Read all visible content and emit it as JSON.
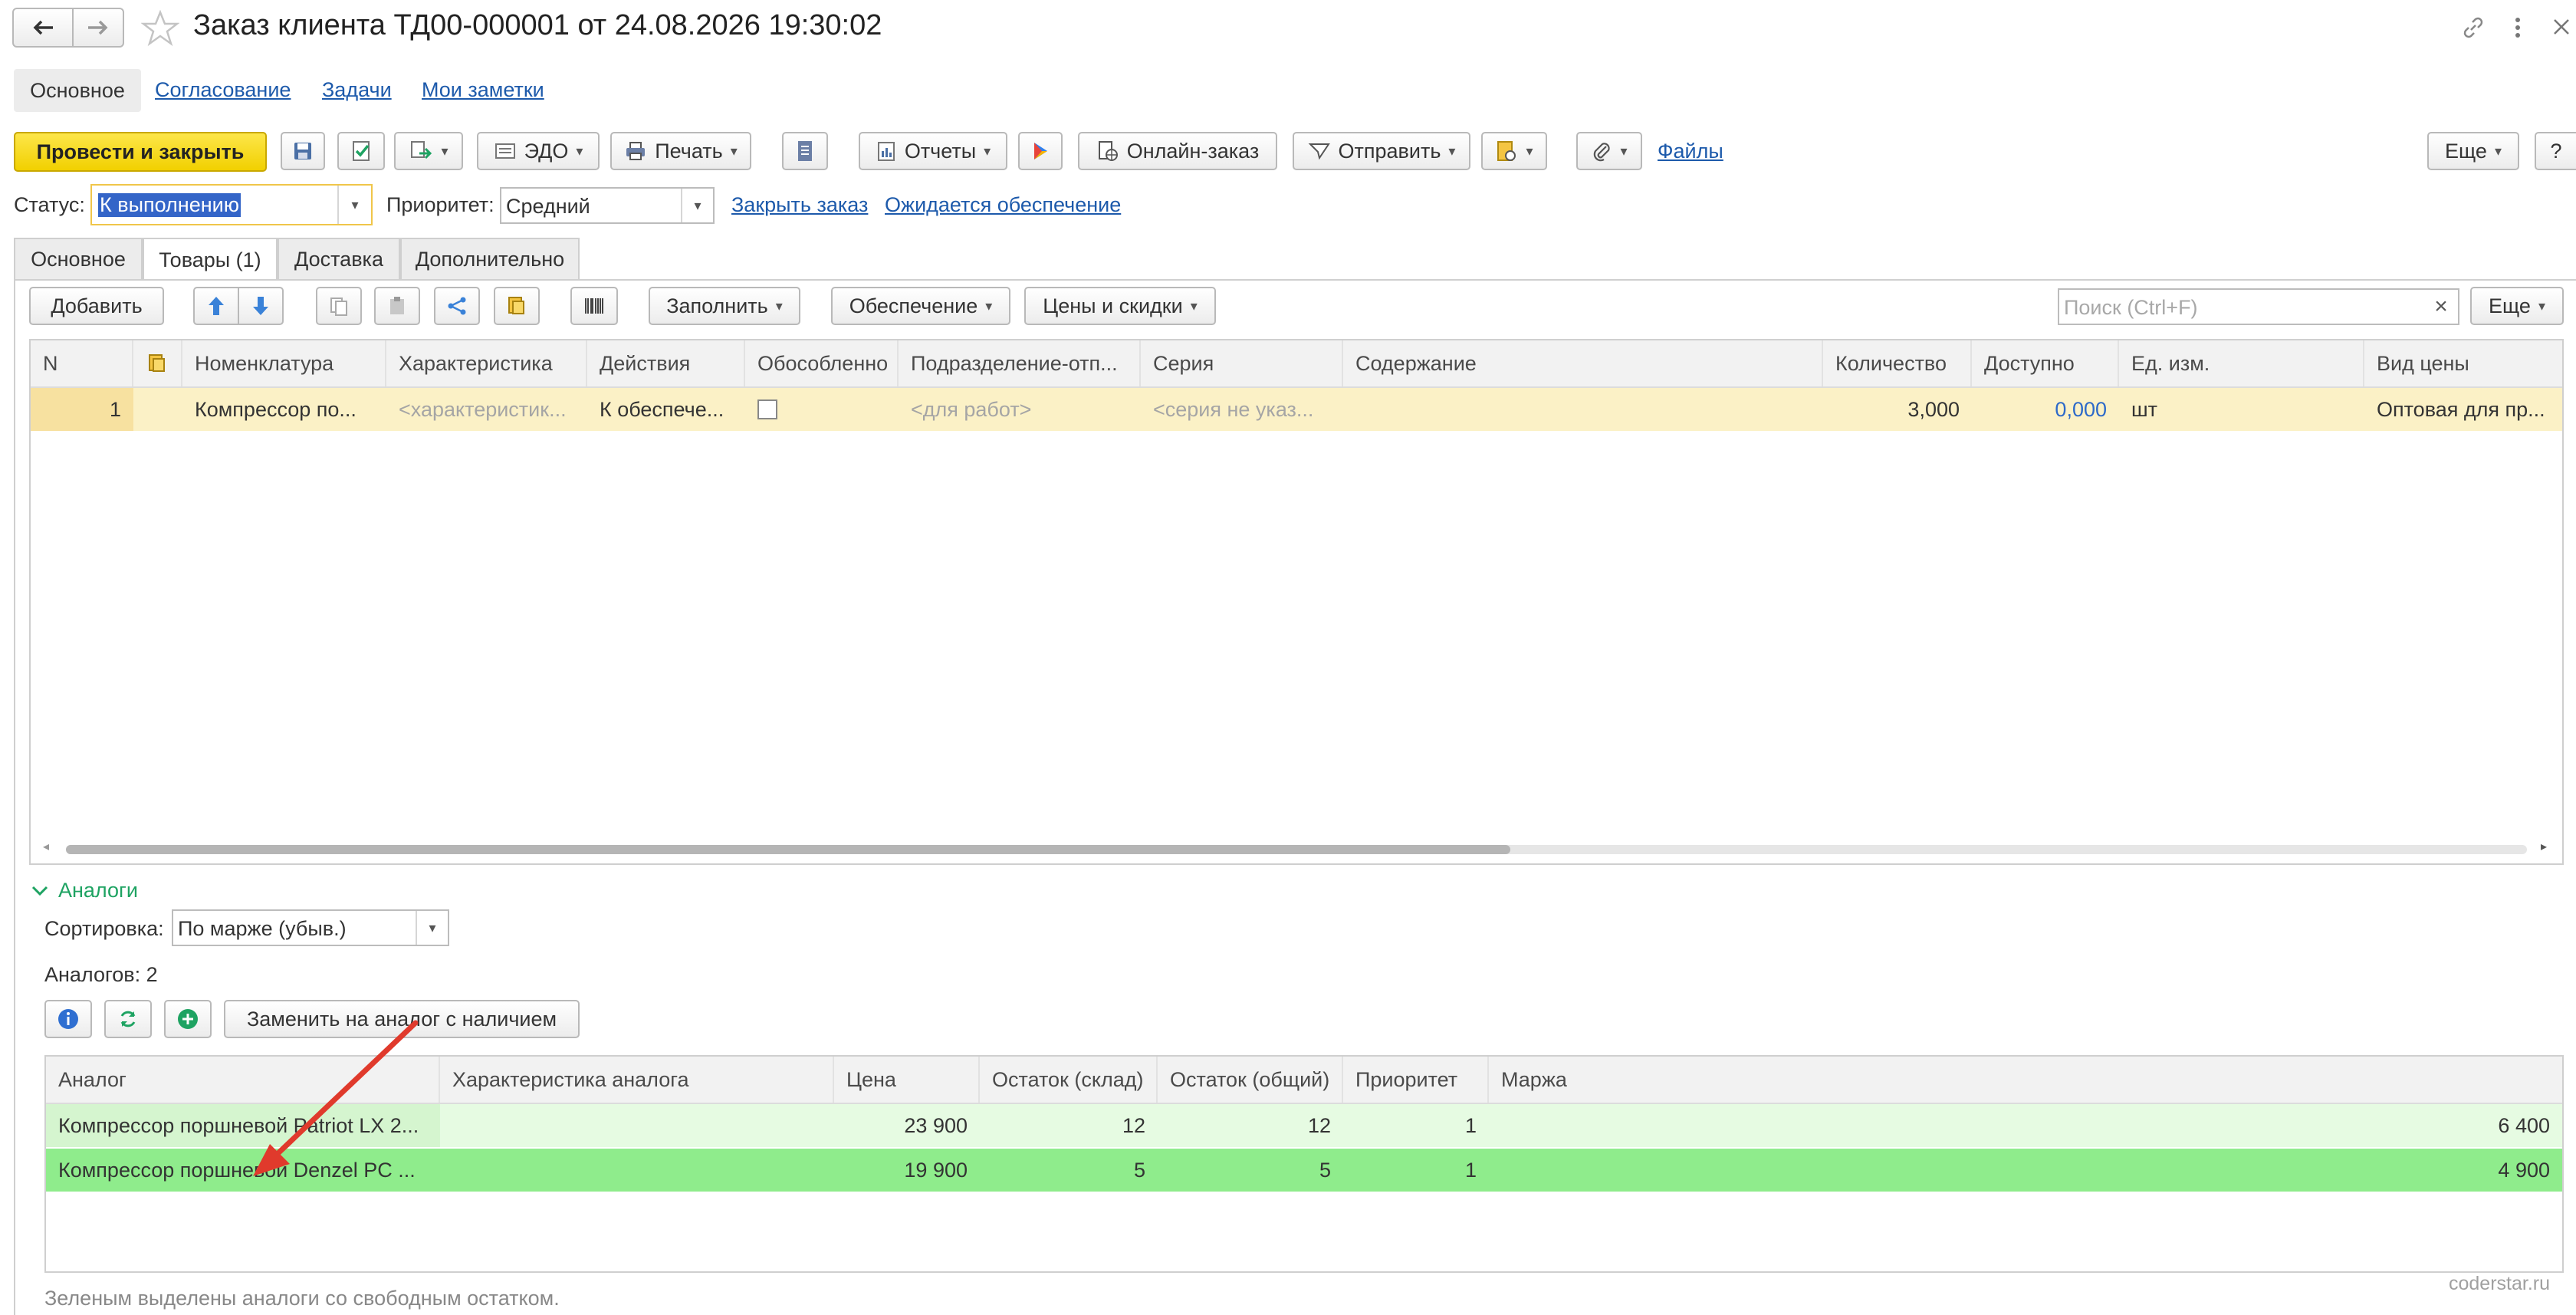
{
  "window": {
    "title": "Заказ клиента ТД00-000001 от 24.08.2026 19:30:02",
    "icons": [
      "back-arrow-icon",
      "forward-arrow-icon",
      "star-icon",
      "link-icon",
      "more-vertical-icon",
      "close-icon"
    ]
  },
  "nav": {
    "items": [
      "Основное",
      "Согласование",
      "Задачи",
      "Мои заметки"
    ]
  },
  "toolbar": {
    "post_close": "Провести и закрыть",
    "edo": "ЭДО",
    "print": "Печать",
    "reports": "Отчеты",
    "online_order": "Онлайн-заказ",
    "send": "Отправить",
    "files": "Файлы",
    "more": "Еще",
    "help": "?"
  },
  "status": {
    "label": "Статус:",
    "value": "К выполнению",
    "priority_label": "Приоритет:",
    "priority_value": "Средний",
    "close_order": "Закрыть заказ",
    "awaiting": "Ожидается обеспечение"
  },
  "tabs": [
    "Основное",
    "Товары (1)",
    "Доставка",
    "Дополнительно"
  ],
  "goods_toolbar": {
    "add": "Добавить",
    "fill": "Заполнить",
    "provision": "Обеспечение",
    "prices": "Цены и скидки",
    "search_placeholder": "Поиск (Ctrl+F)",
    "clear": "×",
    "more": "Еще"
  },
  "goods_table": {
    "columns": [
      "N",
      "",
      "Номенклатура",
      "Характеристика",
      "Действия",
      "Обособленно",
      "Подразделение-отп...",
      "Серия",
      "Содержание",
      "Количество",
      "Доступно",
      "Ед. изм.",
      "Вид цены"
    ],
    "rows": [
      {
        "n": "1",
        "nom": "Компрессор по...",
        "char": "<характеристик...",
        "action": "К обеспече...",
        "separate": false,
        "dept": "<для работ>",
        "series": "<серия не указ...",
        "content": "",
        "qty": "3,000",
        "avail": "0,000",
        "unit": "шт",
        "price_type": "Оптовая для пр..."
      }
    ]
  },
  "analogs": {
    "section_title": "Аналоги",
    "sort_label": "Сортировка:",
    "sort_value": "По марже (убыв.)",
    "count_text": "Аналогов: 2",
    "replace_button": "Заменить на аналог с наличием",
    "columns": [
      "Аналог",
      "Характеристика аналога",
      "Цена",
      "Остаток (склад)",
      "Остаток (общий)",
      "Приоритет",
      "Маржа"
    ],
    "rows": [
      {
        "name": "Компрессор поршневой Patriot LX 2...",
        "char": "",
        "price": "23 900",
        "stock_wh": "12",
        "stock_total": "12",
        "priority": "1",
        "margin": "6 400"
      },
      {
        "name": "Компрессор поршневой Denzel PC ...",
        "char": "",
        "price": "19 900",
        "stock_wh": "5",
        "stock_total": "5",
        "priority": "1",
        "margin": "4 900"
      }
    ],
    "footer_note": "Зеленым выделены аналоги со свободным остатком."
  },
  "watermark": "coderstar.ru",
  "colors": {
    "primary_button": "#f5d80a",
    "selected_row": "#fbf1c6",
    "analog_light": "#e6fbe2",
    "analog_selected": "#8fec8c",
    "link": "#1d5aab",
    "accent_green": "#1ea362"
  }
}
